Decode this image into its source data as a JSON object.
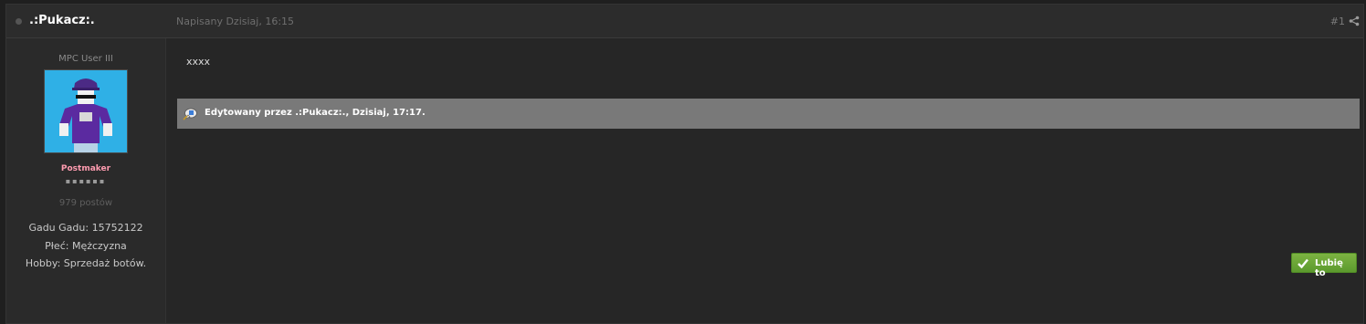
{
  "header": {
    "author": ".:Pukacz:.",
    "date": "Napisany Dzisiaj, 16:15",
    "post_number": "#1",
    "share_icon": "share-icon",
    "status_icon": "offline-dot-icon"
  },
  "sidebar": {
    "user_title": "MPC User III",
    "group_name": "Postmaker",
    "rank_pips": "▪▪▪▪▪▪",
    "post_count": "979 postów",
    "fields": {
      "gadu_gadu": "Gadu Gadu: 15752122",
      "gender": "Płeć: Mężczyzna",
      "hobby": "Hobby: Sprzedaż botów."
    }
  },
  "content": {
    "body": "xxxx",
    "edit_note": "Edytowany przez .:Pukacz:., Dzisiaj, 17:17."
  },
  "actions": {
    "like_label": "Lubię to"
  },
  "colors": {
    "group": "#ff9cb0",
    "like_button": "#6fa83a",
    "edit_bar": "#797979"
  }
}
